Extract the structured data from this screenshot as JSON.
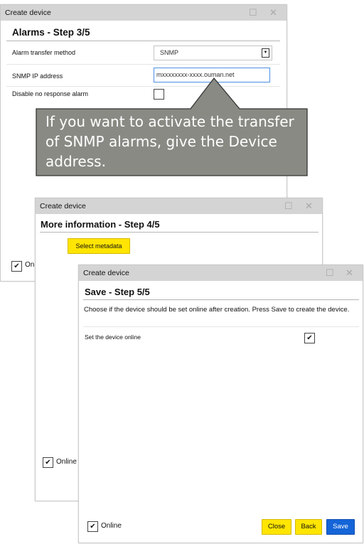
{
  "dialog1": {
    "title": "Create device",
    "step_title": "Alarms - Step 3/5",
    "fields": {
      "transfer_method_label": "Alarm transfer method",
      "transfer_method_value": "SNMP",
      "snmp_ip_label": "SNMP IP address",
      "snmp_ip_value": "mxxxxxxxx-xxxx.ouman.net",
      "no_response_label": "Disable no response alarm"
    },
    "footer_online_label": "On"
  },
  "callout": {
    "text": "If you want to activate the transfer of SNMP alarms, give the Device address."
  },
  "dialog2": {
    "title": "Create device",
    "step_title": "More information - Step 4/5",
    "select_metadata_label": "Select metadata",
    "footer_online_label": "Online"
  },
  "dialog3": {
    "title": "Create device",
    "step_title": "Save - Step 5/5",
    "description": "Choose if the device should be set online after creation. Press Save to create the device.",
    "set_online_label": "Set the device online",
    "footer_online_label": "Online",
    "buttons": {
      "close": "Close",
      "back": "Back",
      "save": "Save"
    }
  },
  "colors": {
    "titlebar_bg": "#d4d4d4",
    "callout_bg": "#8a8a85",
    "yellow_button": "#ffe500",
    "blue_button": "#1565d8"
  }
}
